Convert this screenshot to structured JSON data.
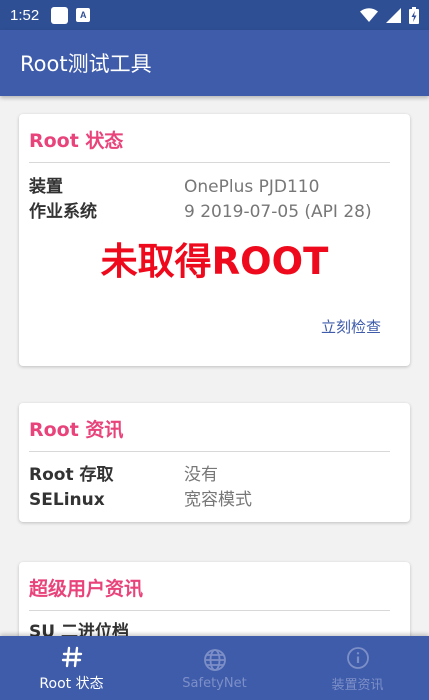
{
  "status_bar": {
    "time": "1:52",
    "notification_badge": "A"
  },
  "app_bar": {
    "title": "Root测试工具"
  },
  "root_status_card": {
    "title": "Root 状态",
    "rows": [
      {
        "label": "装置",
        "value": "OnePlus PJD110"
      },
      {
        "label": "作业系统",
        "value": "9 2019-07-05 (API 28)"
      }
    ],
    "status_text": "未取得ROOT",
    "check_button": "立刻检查"
  },
  "root_info_card": {
    "title": "Root 资讯",
    "rows": [
      {
        "label": "Root 存取",
        "value": "没有"
      },
      {
        "label": "SELinux",
        "value": "宽容模式"
      }
    ]
  },
  "su_info_card": {
    "title": "超级用户资讯",
    "rows": [
      {
        "label": "SU 二进位档",
        "value": ""
      }
    ]
  },
  "bottom_nav": {
    "items": [
      {
        "label": "Root 状态",
        "icon": "hash-icon",
        "active": true
      },
      {
        "label": "SafetyNet",
        "icon": "globe-icon",
        "active": false
      },
      {
        "label": "装置资讯",
        "icon": "info-icon",
        "active": false
      }
    ]
  },
  "colors": {
    "status_bar": "#2f4f95",
    "primary": "#3f5cab",
    "accent": "#e8437a",
    "error": "#ee0a1c",
    "background": "#f2f2f2"
  }
}
